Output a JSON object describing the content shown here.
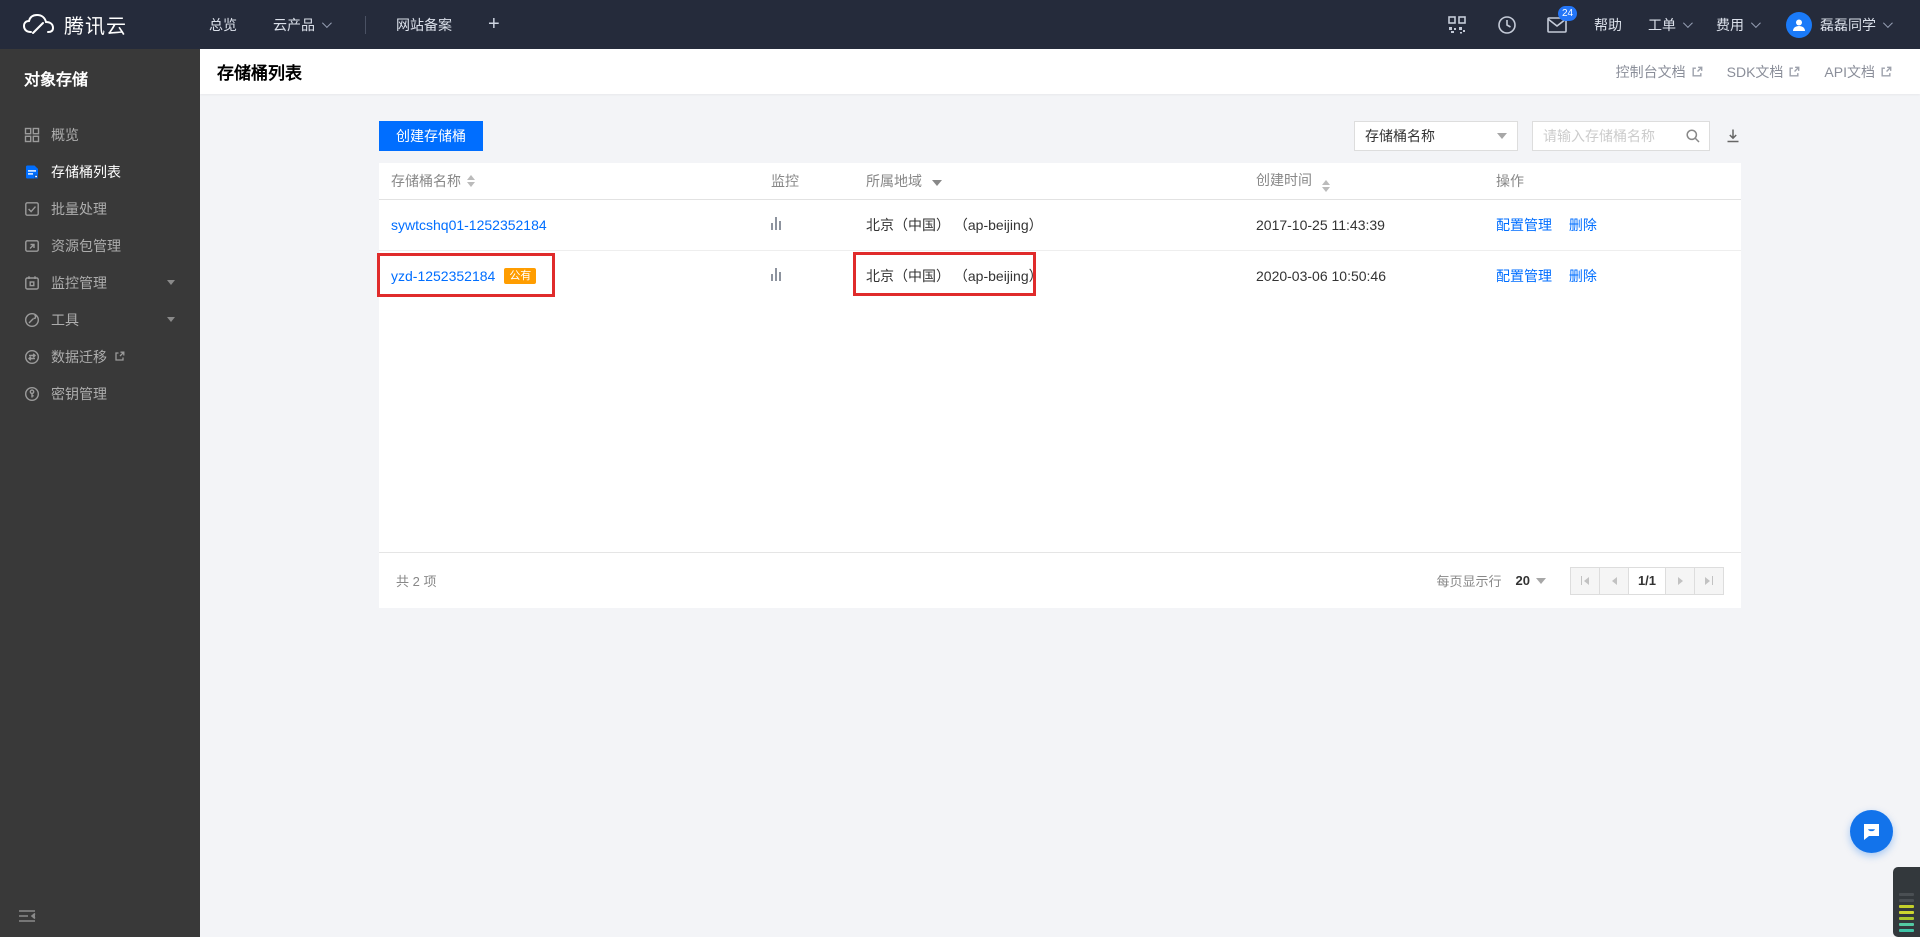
{
  "colors": {
    "accent": "#006eff",
    "badge_orange": "#ff9d00",
    "annotation_red": "#e02b2b",
    "topbar_bg": "#252b3b",
    "sidebar_bg": "#393939"
  },
  "topbar": {
    "brand": "腾讯云",
    "nav_overview": "总览",
    "nav_products": "云产品",
    "nav_beian": "网站备案",
    "nav_plus": "+",
    "mail_badge": "24",
    "help": "帮助",
    "ticket": "工单",
    "billing": "费用",
    "username": "磊磊同学"
  },
  "sidebar": {
    "title": "对象存储",
    "items": [
      {
        "label": "概览",
        "icon": "grid-icon"
      },
      {
        "label": "存储桶列表",
        "icon": "bucket-icon",
        "active": true
      },
      {
        "label": "批量处理",
        "icon": "batch-icon"
      },
      {
        "label": "资源包管理",
        "icon": "package-icon"
      },
      {
        "label": "监控管理",
        "icon": "calendar-icon",
        "expandable": true
      },
      {
        "label": "工具",
        "icon": "tools-icon",
        "expandable": true
      },
      {
        "label": "数据迁移",
        "icon": "migration-icon",
        "external": true
      },
      {
        "label": "密钥管理",
        "icon": "key-icon"
      }
    ]
  },
  "page_header": {
    "title": "存储桶列表",
    "links": [
      {
        "label": "控制台文档"
      },
      {
        "label": "SDK文档"
      },
      {
        "label": "API文档"
      }
    ]
  },
  "toolbar": {
    "create_label": "创建存储桶",
    "filter_value": "存储桶名称",
    "search_placeholder": "请输入存储桶名称"
  },
  "table": {
    "columns": [
      "存储桶名称",
      "监控",
      "所属地域",
      "创建时间",
      "操作"
    ],
    "rows": [
      {
        "name": "sywtcshq01-1252352184",
        "region": "北京（中国） （ap-beijing）",
        "created": "2017-10-25 11:43:39",
        "actions": [
          "配置管理",
          "删除"
        ]
      },
      {
        "name": "yzd-1252352184",
        "badge": "公有",
        "region": "北京（中国） （ap-beijing）",
        "created": "2020-03-06 10:50:46",
        "actions": [
          "配置管理",
          "删除"
        ],
        "annotated": true
      }
    ]
  },
  "footer": {
    "total": "共 2 项",
    "per_page_label": "每页显示行",
    "per_page_value": "20",
    "page_indicator": "1/1"
  }
}
